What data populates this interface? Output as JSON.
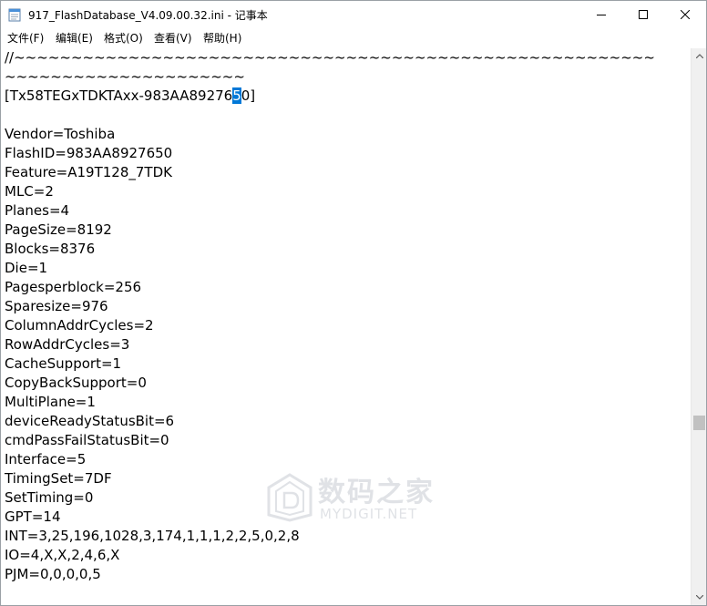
{
  "window": {
    "title": "917_FlashDatabase_V4.09.00.32.ini - 记事本",
    "app_icon": "notepad-icon",
    "controls": [
      "minimize-icon",
      "maximize-icon",
      "close-icon"
    ]
  },
  "menu": {
    "items": [
      {
        "label": "文件(F)"
      },
      {
        "label": "编辑(E)"
      },
      {
        "label": "格式(O)"
      },
      {
        "label": "查看(V)"
      },
      {
        "label": "帮助(H)"
      }
    ]
  },
  "editor": {
    "separator_1": "//~~~~~~~~~~~~~~~~~~~~~~~~~~~~~~~~~~~~~~~~~~~~~~~~~~~~~~~~",
    "separator_2": "~~~~~~~~~~~~~~~~~~~~~",
    "section_before": "[Tx58TEGxTDKTAxx-983AA89276",
    "section_selected": "5",
    "section_after": "0]",
    "lines": [
      "Vendor=Toshiba",
      "FlashID=983AA8927650",
      "Feature=A19T128_7TDK",
      "MLC=2",
      "Planes=4",
      "PageSize=8192",
      "Blocks=8376",
      "Die=1",
      "Pagesperblock=256",
      "Sparesize=976",
      "ColumnAddrCycles=2",
      "RowAddrCycles=3",
      "CacheSupport=1",
      "CopyBackSupport=0",
      "MultiPlane=1",
      "deviceReadyStatusBit=6",
      "cmdPassFailStatusBit=0",
      "Interface=5",
      "TimingSet=7DF",
      "SetTiming=0",
      "GPT=14",
      "INT=3,25,196,1028,3,174,1,1,1,2,2,5,0,2,8",
      "IO=4,X,X,2,4,6,X",
      "PJM=0,0,0,0,5"
    ],
    "selection_color": "#0078d7"
  },
  "watermark": {
    "cn": "数码之家",
    "en": "MYDIGIT.NET",
    "icon": "house-logo-icon"
  }
}
